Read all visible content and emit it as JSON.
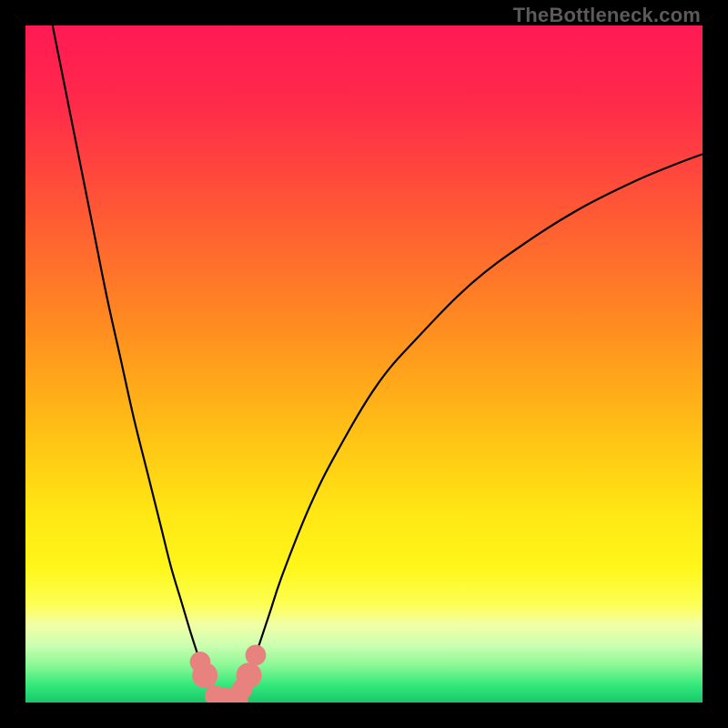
{
  "watermark": {
    "text": "TheBottleneck.com"
  },
  "colors": {
    "black": "#000000",
    "curve": "#000000",
    "marker_fill": "#e8827e",
    "marker_stroke": "#d46a66",
    "gradient_stops": [
      {
        "offset": 0.0,
        "color": "#ff1a54"
      },
      {
        "offset": 0.12,
        "color": "#ff2b4a"
      },
      {
        "offset": 0.28,
        "color": "#ff5a34"
      },
      {
        "offset": 0.45,
        "color": "#ff8e20"
      },
      {
        "offset": 0.6,
        "color": "#ffc015"
      },
      {
        "offset": 0.72,
        "color": "#ffe714"
      },
      {
        "offset": 0.8,
        "color": "#fff61a"
      },
      {
        "offset": 0.855,
        "color": "#fdff54"
      },
      {
        "offset": 0.885,
        "color": "#f1ffa6"
      },
      {
        "offset": 0.915,
        "color": "#ccffb1"
      },
      {
        "offset": 0.945,
        "color": "#8cf896"
      },
      {
        "offset": 0.975,
        "color": "#33e87a"
      },
      {
        "offset": 1.0,
        "color": "#18c76b"
      }
    ]
  },
  "chart_data": {
    "type": "line",
    "title": "",
    "xlabel": "",
    "ylabel": "",
    "xlim": [
      0,
      100
    ],
    "ylim": [
      0,
      100
    ],
    "grid": false,
    "series": [
      {
        "name": "left-branch",
        "x": [
          4,
          6,
          8,
          10,
          12,
          14,
          16,
          18,
          20,
          21.5,
          23,
          24.5,
          25.8,
          26.5,
          27,
          28,
          29,
          30
        ],
        "y": [
          100,
          90,
          80,
          70,
          60,
          51,
          42,
          34,
          26,
          20,
          15,
          10,
          6,
          4,
          2.5,
          1,
          0.4,
          0
        ]
      },
      {
        "name": "right-branch",
        "x": [
          30,
          31,
          32,
          33,
          34,
          36,
          38,
          42,
          46,
          52,
          58,
          66,
          74,
          82,
          90,
          96,
          100
        ],
        "y": [
          0,
          0.5,
          2,
          4,
          7,
          13,
          19,
          29,
          37,
          47,
          54,
          62,
          68,
          73,
          77,
          79.5,
          81
        ]
      }
    ],
    "markers": [
      {
        "x": 25.8,
        "y": 6,
        "r": 1.1
      },
      {
        "x": 26.5,
        "y": 4,
        "r": 1.5
      },
      {
        "x": 28.0,
        "y": 1,
        "r": 1.1
      },
      {
        "x": 29.0,
        "y": 0.4,
        "r": 1.5
      },
      {
        "x": 30.0,
        "y": 0.2,
        "r": 1.1
      },
      {
        "x": 31.0,
        "y": 0.5,
        "r": 1.5
      },
      {
        "x": 32.0,
        "y": 2,
        "r": 1.1
      },
      {
        "x": 33.0,
        "y": 4,
        "r": 1.5
      },
      {
        "x": 34.0,
        "y": 7,
        "r": 1.1
      }
    ]
  }
}
